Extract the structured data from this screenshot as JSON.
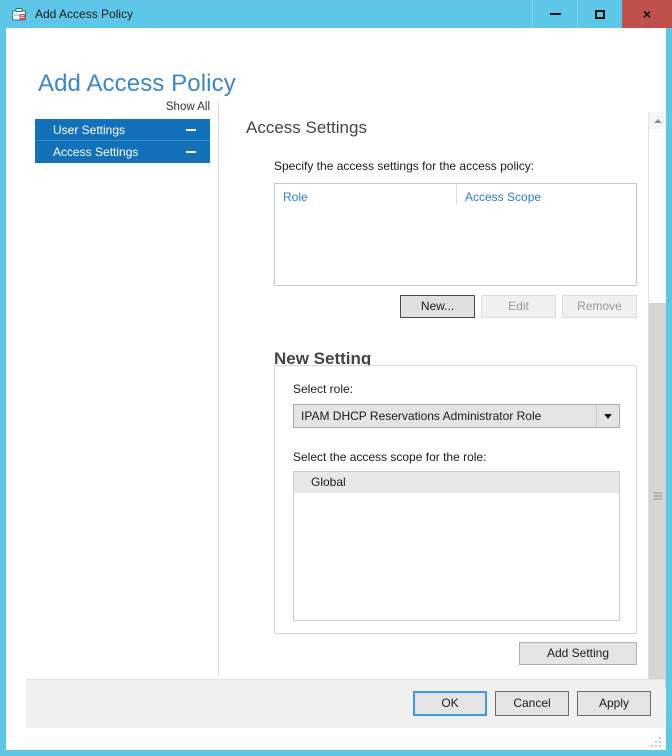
{
  "window": {
    "title": "Add Access Policy",
    "icon": "access-policy-icon",
    "controls": {
      "minimize": "minimize-button",
      "maximize": "maximize-button",
      "close": "×"
    },
    "close_color": "#c0504c",
    "titlebar_color": "#5ec7e8"
  },
  "page": {
    "title": "Add Access Policy",
    "title_color": "#3b87c4"
  },
  "sidebar": {
    "show_all_label": "Show All",
    "accent_color": "#1271b8",
    "items": [
      {
        "label": "User Settings",
        "collapse_icon": "minus-icon",
        "selected": true
      },
      {
        "label": "Access Settings",
        "collapse_icon": "minus-icon",
        "selected": true
      }
    ]
  },
  "main": {
    "section_title": "Access Settings",
    "instruction": "Specify the access settings for the access policy:",
    "listview": {
      "columns": [
        "Role",
        "Access Scope"
      ],
      "rows": [],
      "header_link_color": "#2a7fc9"
    },
    "listview_buttons": [
      {
        "label": "New...",
        "state": "focused"
      },
      {
        "label": "Edit",
        "state": "disabled"
      },
      {
        "label": "Remove",
        "state": "disabled"
      }
    ],
    "new_setting": {
      "title": "New Setting",
      "role_label": "Select role:",
      "role_value": "IPAM DHCP Reservations Administrator Role",
      "role_dropdown_icon": "chevron-down-icon",
      "scope_label": "Select the access scope for the role:",
      "scope_items": [
        {
          "label": "Global",
          "selected": true
        }
      ],
      "add_button_label": "Add Setting"
    }
  },
  "scrollbar": {
    "up_icon": "chevron-up-icon",
    "down_icon": "chevron-down-icon",
    "grip_icon": "grip-lines-icon"
  },
  "footer": {
    "buttons": [
      {
        "label": "OK",
        "state": "default"
      },
      {
        "label": "Cancel",
        "state": "normal"
      },
      {
        "label": "Apply",
        "state": "normal"
      }
    ],
    "resize_grip_icon": "resize-grip-icon"
  }
}
